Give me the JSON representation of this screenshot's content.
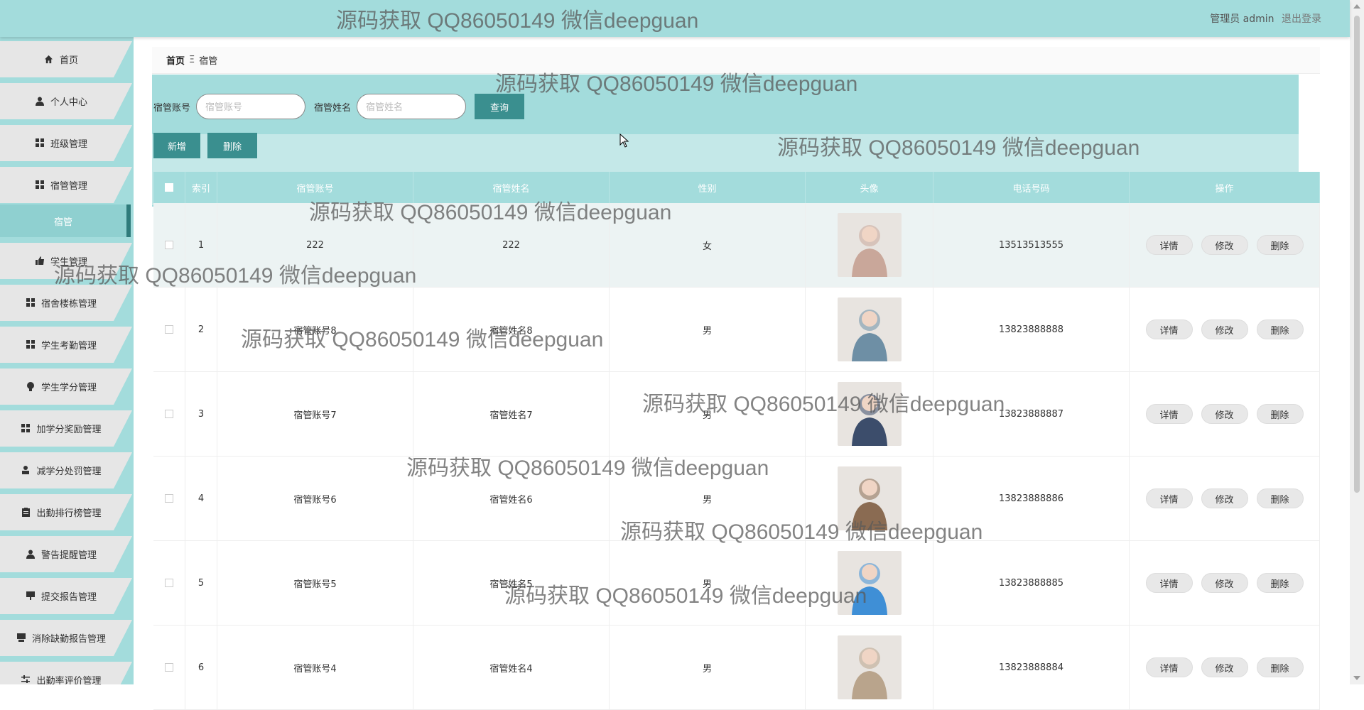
{
  "topbar": {
    "user_label": "管理员 admin",
    "logout": "退出登录"
  },
  "sidebar": {
    "items": [
      {
        "label": "首页",
        "icon": "home-icon"
      },
      {
        "label": "个人中心",
        "icon": "user-icon"
      },
      {
        "label": "班级管理",
        "icon": "grid-icon"
      },
      {
        "label": "宿管管理",
        "icon": "grid-icon"
      },
      {
        "label": "宿管",
        "icon": "",
        "sub": true
      },
      {
        "label": "学生管理",
        "icon": "thumb-icon"
      },
      {
        "label": "宿舍楼栋管理",
        "icon": "grid-icon"
      },
      {
        "label": "学生考勤管理",
        "icon": "grid-icon"
      },
      {
        "label": "学生学分管理",
        "icon": "bulb-icon"
      },
      {
        "label": "加学分奖励管理",
        "icon": "grid-icon"
      },
      {
        "label": "减学分处罚管理",
        "icon": "person-icon"
      },
      {
        "label": "出勤排行榜管理",
        "icon": "clipboard-icon"
      },
      {
        "label": "警告提醒管理",
        "icon": "user-icon"
      },
      {
        "label": "提交报告管理",
        "icon": "board-icon"
      },
      {
        "label": "消除缺勤报告管理",
        "icon": "board-icon"
      },
      {
        "label": "出勤率评价管理",
        "icon": "sliders-icon"
      }
    ]
  },
  "breadcrumb": {
    "home": "首页",
    "sep": "Ξ",
    "current": "宿管"
  },
  "search": {
    "account_label": "宿管账号",
    "account_placeholder": "宿管账号",
    "name_label": "宿管姓名",
    "name_placeholder": "宿管姓名",
    "query_button": "查询"
  },
  "actions": {
    "add": "新增",
    "delete": "删除"
  },
  "table": {
    "headers": [
      "索引",
      "宿管账号",
      "宿管姓名",
      "性别",
      "头像",
      "电话号码",
      "操作"
    ],
    "rows": [
      {
        "index": "1",
        "account": "222",
        "name": "222",
        "gender": "女",
        "phone": "13513513555",
        "avatar_color": "#c9a79a"
      },
      {
        "index": "2",
        "account": "宿管账号8",
        "name": "宿管姓名8",
        "gender": "男",
        "phone": "13823888888",
        "avatar_color": "#6e8fa5"
      },
      {
        "index": "3",
        "account": "宿管账号7",
        "name": "宿管姓名7",
        "gender": "男",
        "phone": "13823888887",
        "avatar_color": "#3c4d6b"
      },
      {
        "index": "4",
        "account": "宿管账号6",
        "name": "宿管姓名6",
        "gender": "男",
        "phone": "13823888886",
        "avatar_color": "#8a6b52"
      },
      {
        "index": "5",
        "account": "宿管账号5",
        "name": "宿管姓名5",
        "gender": "男",
        "phone": "13823888885",
        "avatar_color": "#3f8fd6"
      },
      {
        "index": "6",
        "account": "宿管账号4",
        "name": "宿管姓名4",
        "gender": "男",
        "phone": "13823888884",
        "avatar_color": "#b9a48c"
      }
    ],
    "op_detail": "详情",
    "op_edit": "修改",
    "op_delete": "删除"
  },
  "watermark": "源码获取 QQ86050149 微信deepguan",
  "colors": {
    "primary": "#a3dcdc",
    "button": "#3a8f8f",
    "sidebar_item": "#e6e6e6"
  }
}
